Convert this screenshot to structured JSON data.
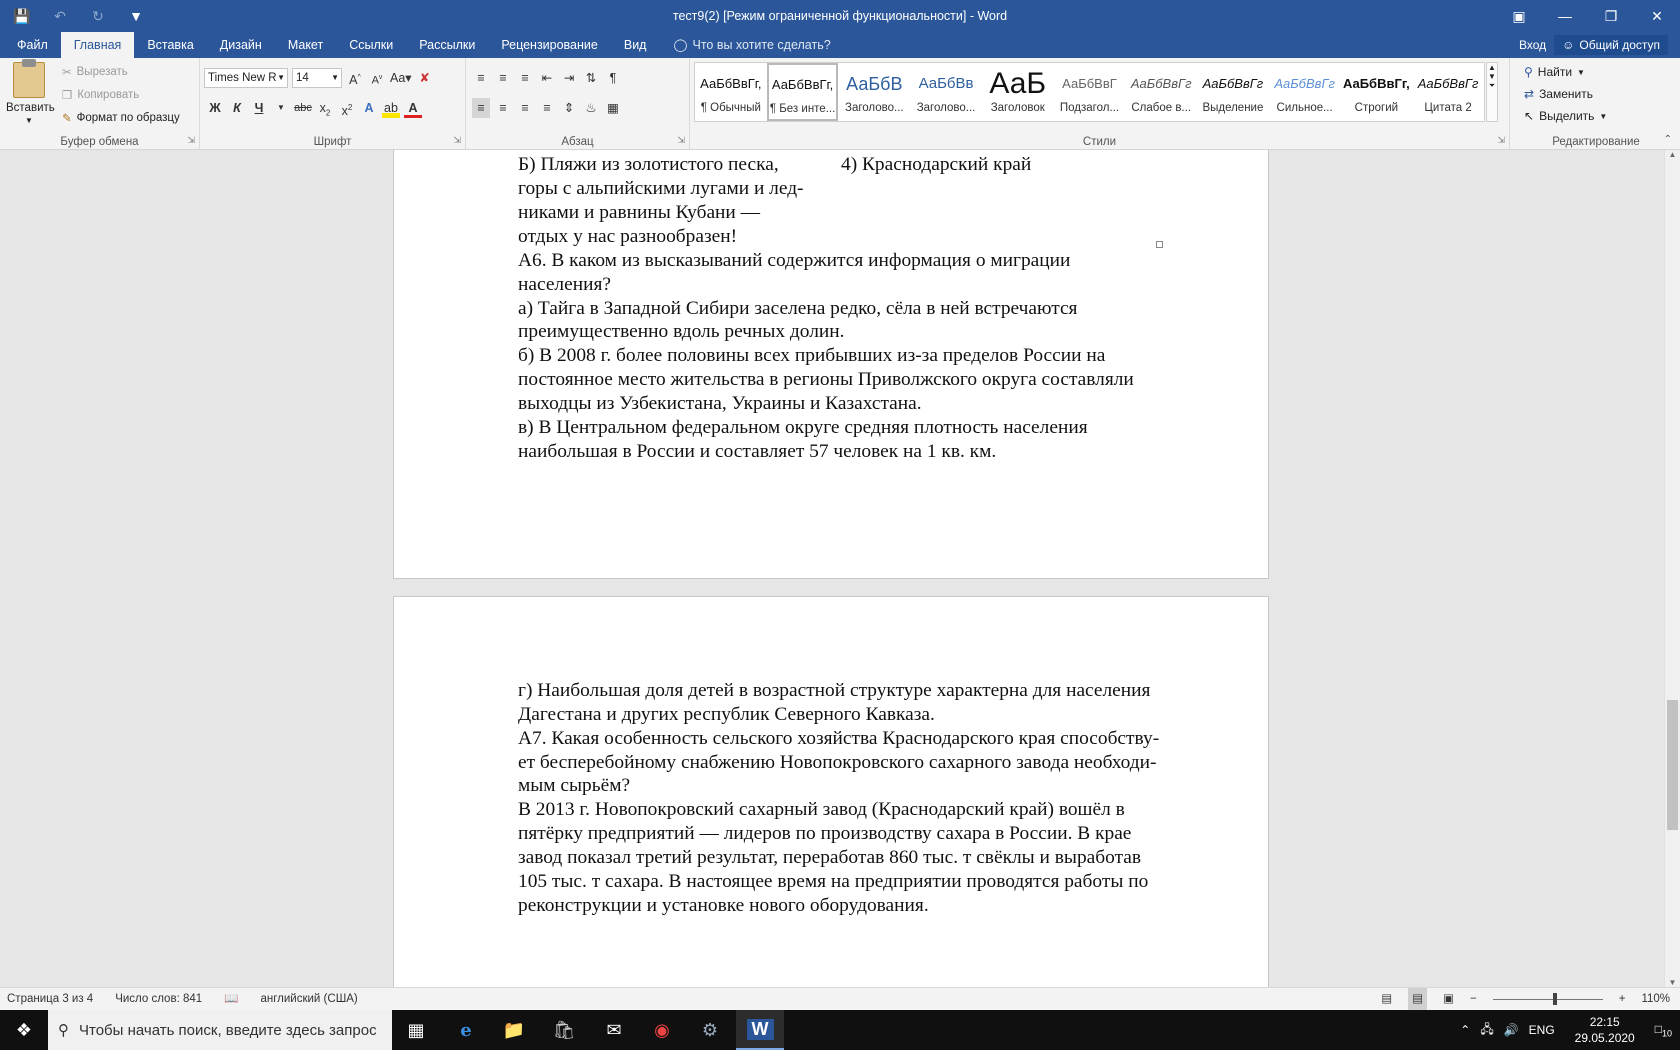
{
  "window": {
    "title": "тест9(2) [Режим ограниченной функциональности] - Word"
  },
  "tabs": [
    "Файл",
    "Главная",
    "Вставка",
    "Дизайн",
    "Макет",
    "Ссылки",
    "Рассылки",
    "Рецензирование",
    "Вид"
  ],
  "active_tab": "Главная",
  "tell_me": "Что вы хотите сделать?",
  "account": {
    "signin": "Вход",
    "share": "Общий доступ"
  },
  "clipboard": {
    "paste": "Вставить",
    "cut": "Вырезать",
    "copy": "Копировать",
    "format_painter": "Формат по образцу",
    "label": "Буфер обмена"
  },
  "font": {
    "name": "Times New R",
    "size": "14",
    "label": "Шрифт"
  },
  "paragraph": {
    "label": "Абзац"
  },
  "styles": {
    "label": "Стили",
    "items": [
      {
        "sample": "АаБбВвГг,",
        "name": "¶ Обычный"
      },
      {
        "sample": "АаБбВвГг,",
        "name": "¶ Без инте..."
      },
      {
        "sample": "АаБбВ",
        "name": "Заголово..."
      },
      {
        "sample": "АаБбВв",
        "name": "Заголово..."
      },
      {
        "sample": "АаБ",
        "name": "Заголовок"
      },
      {
        "sample": "АаБбВвГ",
        "name": "Подзагол..."
      },
      {
        "sample": "АаБбВвГг",
        "name": "Слабое в..."
      },
      {
        "sample": "АаБбВвГг",
        "name": "Выделение"
      },
      {
        "sample": "АаБбВвГг",
        "name": "Сильное..."
      },
      {
        "sample": "АаБбВвГг,",
        "name": "Строгий"
      },
      {
        "sample": "АаБбВвГг",
        "name": "Цитата 2"
      }
    ]
  },
  "editing": {
    "find": "Найти",
    "replace": "Заменить",
    "select": "Выделить",
    "label": "Редактирование"
  },
  "page1": {
    "lines": [
      "Б) Пляжи из золотистого песка,",
      "горы с альпийскими лугами и лед-",
      "никами и равнины Кубани —",
      "отдых у нас разнообразен!"
    ],
    "right_col": "4) Краснодарский край",
    "body": [
      "А6. В каком из высказываний содержится информация о миграции",
      "населения?",
      "а) Тайга в Западной Сибири заселена редко, сёла в ней встречаются",
      "преимущественно вдоль речных долин.",
      "б) В 2008 г. более половины всех прибывших из-за пределов России на",
      "постоянное место жительства в регионы Приволжского округа составляли",
      "выходцы из Узбекистана, Украины и Казахстана.",
      "в) В Центральном федеральном округе средняя плотность населения",
      "наибольшая в России и составляет 57 человек на 1 кв. км."
    ]
  },
  "page2": {
    "lines": [
      "г) Наибольшая доля детей в возрастной структуре характерна для населения",
      "Дагестана и других республик Северного Кавказа.",
      "А7. Какая особенность сельского хозяйства Краснодарского края способству-",
      "ет бесперебойному снабжению Новопокровского сахарного завода необходи-",
      "мым сырьём?",
      "В 2013 г. Новопокровский сахарный завод (Краснодарский край) вошёл в",
      "пятёрку предприятий — лидеров по производству сахара в России. В крае",
      "завод показал третий результат, переработав 860 тыс. т свёклы и выработав",
      "105 тыс. т сахара. В настоящее время на предприятии проводятся работы по",
      "реконструкции и установке нового оборудования."
    ]
  },
  "status": {
    "page": "Страница 3 из 4",
    "words": "Число слов: 841",
    "language": "английский (США)",
    "zoom": "110%"
  },
  "taskbar": {
    "search_placeholder": "Чтобы начать поиск, введите здесь запрос",
    "lang": "ENG",
    "time": "22:15",
    "date": "29.05.2020",
    "notifications": "10"
  }
}
